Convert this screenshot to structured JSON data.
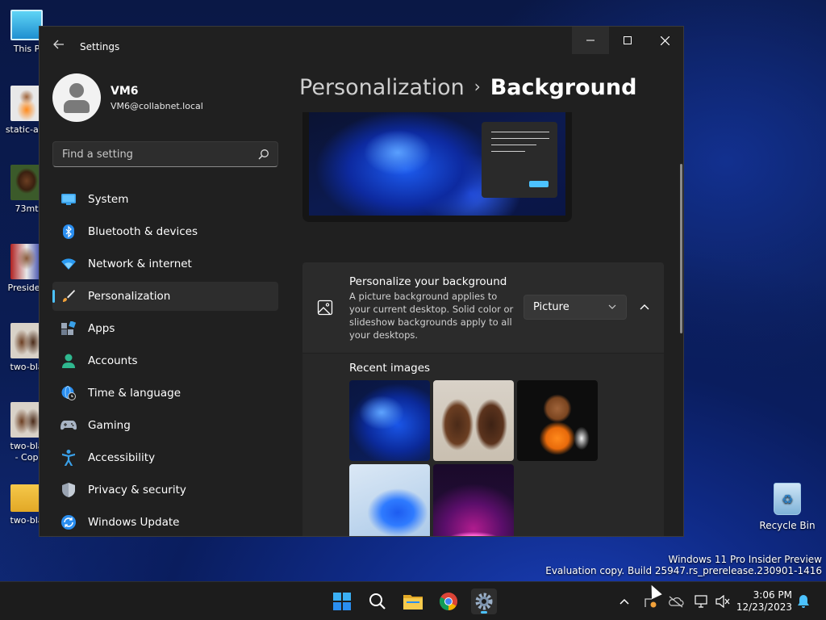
{
  "desktop": {
    "icons": [
      {
        "label": "This P"
      },
      {
        "label": "static-ass"
      },
      {
        "label": "73mt"
      },
      {
        "label": "Presiden"
      },
      {
        "label": "two-bla"
      },
      {
        "label": "two-bla\n- Cop"
      },
      {
        "label": "two-bla"
      }
    ],
    "recycle_bin": "Recycle Bin",
    "watermark_line1": "Windows 11 Pro Insider Preview",
    "watermark_line2": "Evaluation copy. Build 25947.rs_prerelease.230901-1416"
  },
  "window": {
    "title": "Settings",
    "controls": {
      "minimize": "—",
      "maximize": "☐",
      "close": "✕"
    }
  },
  "profile": {
    "name": "VM6",
    "email": "VM6@collabnet.local"
  },
  "search": {
    "placeholder": "Find a setting"
  },
  "nav": {
    "items": [
      {
        "label": "System",
        "icon": "system-icon"
      },
      {
        "label": "Bluetooth & devices",
        "icon": "bluetooth-icon"
      },
      {
        "label": "Network & internet",
        "icon": "wifi-icon"
      },
      {
        "label": "Personalization",
        "icon": "brush-icon",
        "active": true
      },
      {
        "label": "Apps",
        "icon": "apps-icon"
      },
      {
        "label": "Accounts",
        "icon": "person-icon"
      },
      {
        "label": "Time & language",
        "icon": "globe-clock-icon"
      },
      {
        "label": "Gaming",
        "icon": "gamepad-icon"
      },
      {
        "label": "Accessibility",
        "icon": "accessibility-icon"
      },
      {
        "label": "Privacy & security",
        "icon": "shield-icon"
      },
      {
        "label": "Windows Update",
        "icon": "update-icon"
      }
    ]
  },
  "content": {
    "breadcrumb_parent": "Personalization",
    "breadcrumb_separator": "›",
    "breadcrumb_current": "Background",
    "background_card": {
      "title": "Personalize your background",
      "description": "A picture background applies to your current desktop. Solid color or slideshow backgrounds apply to all your desktops.",
      "selected": "Picture"
    },
    "recent_images_title": "Recent images"
  },
  "taskbar": {
    "time": "3:06 PM",
    "date": "12/23/2023"
  },
  "colors": {
    "accent": "#4cc2ff",
    "window_bg": "#202020",
    "card_bg": "#2b2b2b"
  }
}
